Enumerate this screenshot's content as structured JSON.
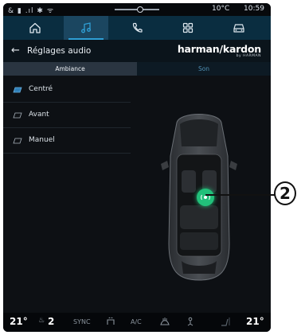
{
  "status_bar": {
    "left_icons": "& ▮ .ıl ✱ ᯤ",
    "temperature": "10°C",
    "time": "10:59"
  },
  "nav": {
    "tabs": [
      {
        "icon": "home-icon"
      },
      {
        "icon": "music-icon",
        "active": true
      },
      {
        "icon": "phone-icon"
      },
      {
        "icon": "apps-grid-icon"
      },
      {
        "icon": "car-icon"
      }
    ]
  },
  "header": {
    "back_symbol": "←",
    "title": "Réglages audio",
    "brand": "harman/kardon",
    "brand_sub": "by HARMAN"
  },
  "sub_tabs": [
    {
      "label": "Ambiance",
      "active": true
    },
    {
      "label": "Son",
      "active": false
    }
  ],
  "options": [
    {
      "label": "Centré",
      "selected": true
    },
    {
      "label": "Avant",
      "selected": false
    },
    {
      "label": "Manuel",
      "selected": false
    }
  ],
  "sweet_spot": {
    "icon": "sound-position-icon"
  },
  "callout": {
    "label": "2"
  },
  "bottom_bar": {
    "temp_left": "21°",
    "seat_left": "2",
    "sync": "SYNC",
    "ac": "A/C",
    "temp_right": "21°"
  },
  "colors": {
    "accent": "#2f9fd6",
    "nav_bg": "#0a2d40",
    "sweet_spot": "#22c07a"
  }
}
